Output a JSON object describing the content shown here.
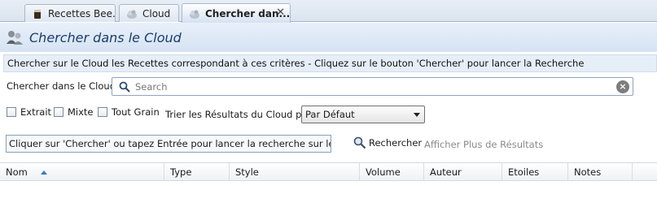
{
  "tabs": [
    {
      "label": "Recettes Bee...",
      "icon": "beer-glass-icon",
      "active": false
    },
    {
      "label": "Cloud",
      "icon": "cloud-search-icon",
      "active": false
    },
    {
      "label": "Chercher dan...",
      "icon": "cloud-search-icon",
      "active": true
    }
  ],
  "tab_close": "✕",
  "header": {
    "title": "Chercher dans le Cloud",
    "icon": "users-cloud-icon"
  },
  "banner": "Chercher sur le Cloud les Recettes correspondant à ces critères - Cliquez sur le bouton 'Chercher' pour lancer la Recherche",
  "search": {
    "label": "Chercher dans le Cloud",
    "placeholder": "Search",
    "value": ""
  },
  "filters": [
    {
      "label": "Extrait",
      "checked": false
    },
    {
      "label": "Mixte",
      "checked": false
    },
    {
      "label": "Tout Grain",
      "checked": false
    }
  ],
  "sort": {
    "label": "Trier les Résultats du Cloud par",
    "selected": "Par Défaut"
  },
  "status": "Cliquer sur 'Chercher' ou tapez Entrée pour lancer la recherche sur le Cloud",
  "buttons": {
    "search": "Rechercher",
    "more": "Afficher Plus de Résultats"
  },
  "columns": [
    "Nom",
    "Type",
    "Style",
    "Volume",
    "Auteur",
    "Etoiles",
    "Notes"
  ],
  "colors": {
    "accent": "#1a3d6e",
    "header_bg": "#d6e3f3",
    "disabled_text": "#8a8a8a"
  }
}
